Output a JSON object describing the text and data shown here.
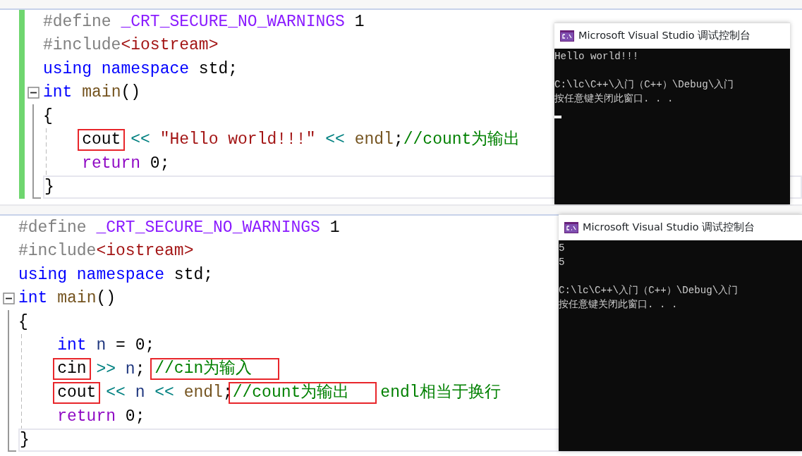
{
  "panels": [
    {
      "change_bar": true,
      "code": [
        {
          "tokens": [
            {
              "text": "#define ",
              "kind": "preproc"
            },
            {
              "text": "_CRT_SECURE_NO_WARNINGS",
              "kind": "macro"
            },
            {
              "text": " 1",
              "kind": "plain"
            }
          ]
        },
        {
          "tokens": [
            {
              "text": "#include",
              "kind": "preproc"
            },
            {
              "text": "<iostream>",
              "kind": "include"
            }
          ]
        },
        {
          "tokens": [
            {
              "text": "using namespace",
              "kind": "keyword"
            },
            {
              "text": " std;",
              "kind": "plain"
            }
          ]
        },
        {
          "tokens": [
            {
              "text": "int",
              "kind": "keyword"
            },
            {
              "text": " main",
              "kind": "func"
            },
            {
              "text": "()",
              "kind": "plain"
            }
          ],
          "expanded": true,
          "children": [
            {
              "tokens": [
                {
                  "text": "{",
                  "kind": "plain"
                }
              ],
              "children": [
                {
                  "tokens": [
                    {
                      "text": "cout",
                      "kind": "plain",
                      "boxed": true
                    },
                    {
                      "text": " << ",
                      "kind": "op"
                    },
                    {
                      "text": "\"Hello world!!!\"",
                      "kind": "string"
                    },
                    {
                      "text": " << ",
                      "kind": "op"
                    },
                    {
                      "text": "endl",
                      "kind": "func"
                    },
                    {
                      "text": ";",
                      "kind": "plain"
                    },
                    {
                      "text": "//count为输出",
                      "kind": "comment"
                    }
                  ]
                },
                {
                  "tokens": [
                    {
                      "text": "return",
                      "kind": "control"
                    },
                    {
                      "text": " 0;",
                      "kind": "plain"
                    }
                  ]
                }
              ]
            },
            {
              "tokens": [
                {
                  "text": "}",
                  "kind": "plain"
                }
              ],
              "current": true
            }
          ]
        }
      ],
      "console": {
        "title": "Microsoft Visual Studio 调试控制台",
        "cursor": true,
        "lines": [
          {
            "kind": "text",
            "text": "Hello world!!!"
          },
          {
            "kind": "blank"
          },
          {
            "kind": "text",
            "text": "C:\\lc\\C++\\入门（C++）\\Debug\\入门"
          },
          {
            "kind": "text",
            "text": "按任意键关闭此窗口. . ."
          }
        ]
      }
    },
    {
      "change_bar": false,
      "code": [
        {
          "tokens": [
            {
              "text": "#define ",
              "kind": "preproc"
            },
            {
              "text": "_CRT_SECURE_NO_WARNINGS",
              "kind": "macro"
            },
            {
              "text": " 1",
              "kind": "plain"
            }
          ]
        },
        {
          "tokens": [
            {
              "text": "#include",
              "kind": "preproc"
            },
            {
              "text": "<iostream>",
              "kind": "include"
            }
          ]
        },
        {
          "tokens": [
            {
              "text": "using namespace",
              "kind": "keyword"
            },
            {
              "text": " std;",
              "kind": "plain"
            }
          ]
        },
        {
          "tokens": [
            {
              "text": "int",
              "kind": "keyword"
            },
            {
              "text": " main",
              "kind": "func"
            },
            {
              "text": "()",
              "kind": "plain"
            }
          ],
          "expanded": true,
          "children": [
            {
              "tokens": [
                {
                  "text": "{",
                  "kind": "plain"
                }
              ],
              "children": [
                {
                  "tokens": [
                    {
                      "text": "int",
                      "kind": "keyword"
                    },
                    {
                      "text": " n",
                      "kind": "var"
                    },
                    {
                      "text": " = 0;",
                      "kind": "plain"
                    }
                  ]
                },
                {
                  "tokens": [
                    {
                      "text": "cin",
                      "kind": "plain",
                      "boxed": true
                    },
                    {
                      "text": " >> ",
                      "kind": "op"
                    },
                    {
                      "text": "n",
                      "kind": "var"
                    },
                    {
                      "text": "; ",
                      "kind": "plain"
                    },
                    {
                      "text": "//cin为输入",
                      "kind": "comment",
                      "boxed": true
                    }
                  ]
                },
                {
                  "tokens": [
                    {
                      "text": "cout",
                      "kind": "plain",
                      "boxed": true
                    },
                    {
                      "text": " << ",
                      "kind": "op"
                    },
                    {
                      "text": "n",
                      "kind": "var"
                    },
                    {
                      "text": " << ",
                      "kind": "op"
                    },
                    {
                      "text": "endl",
                      "kind": "func"
                    },
                    {
                      "text": ";",
                      "kind": "plain"
                    },
                    {
                      "text": "//count为输出",
                      "kind": "comment",
                      "boxed": true
                    }
                  ],
                  "note": "endl相当于换行"
                },
                {
                  "tokens": [
                    {
                      "text": "return",
                      "kind": "control"
                    },
                    {
                      "text": " 0;",
                      "kind": "plain"
                    }
                  ]
                }
              ]
            },
            {
              "tokens": [
                {
                  "text": "}",
                  "kind": "plain"
                }
              ],
              "current": true
            }
          ]
        }
      ],
      "console": {
        "title": "Microsoft Visual Studio 调试控制台",
        "cursor": false,
        "lines": [
          {
            "kind": "text",
            "text": "5"
          },
          {
            "kind": "text",
            "text": "5"
          },
          {
            "kind": "blank"
          },
          {
            "kind": "text",
            "text": "C:\\lc\\C++\\入门（C++）\\Debug\\入门"
          },
          {
            "kind": "text",
            "text": "按任意键关闭此窗口. . ."
          }
        ]
      }
    }
  ]
}
